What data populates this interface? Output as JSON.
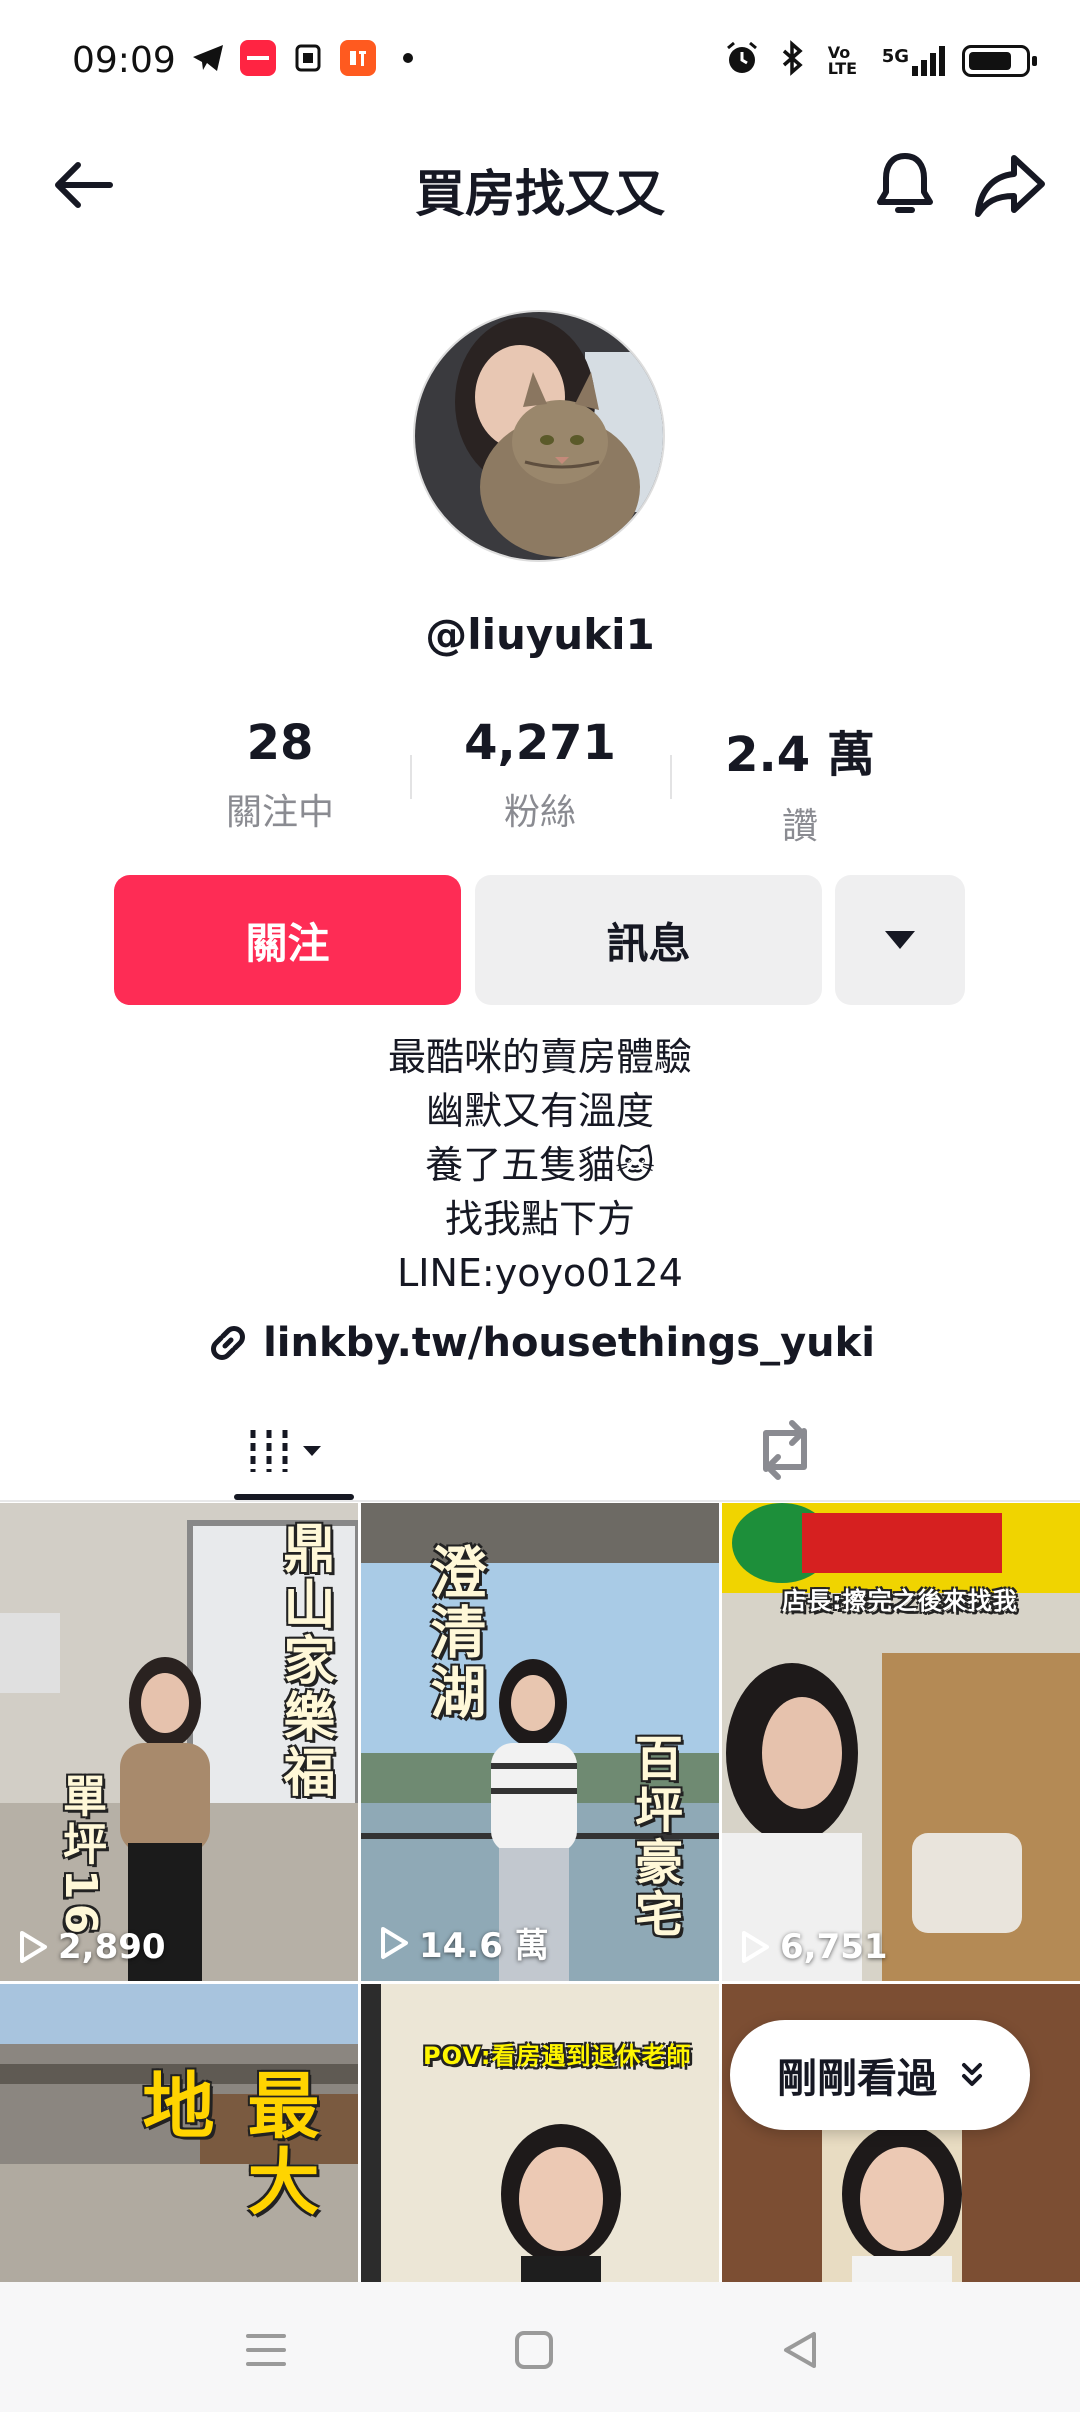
{
  "status_bar": {
    "time": "09:09",
    "left_icons": [
      "telegram-icon",
      "xiaohongshu-icon",
      "notes-icon",
      "ting-icon",
      "dot-icon"
    ],
    "right_icons": [
      "alarm-icon",
      "bluetooth-icon",
      "volte-icon",
      "5g-signal-icon",
      "battery-icon"
    ],
    "network_label": "5G",
    "volte_label": "Vo LTE",
    "battery_level": 0.75
  },
  "header": {
    "title": "買房找又又"
  },
  "profile": {
    "username": "@liuyuki1",
    "stats": [
      {
        "value": "28",
        "label": "關注中"
      },
      {
        "value": "4,271",
        "label": "粉絲"
      },
      {
        "value": "2.4 萬",
        "label": "讚"
      }
    ],
    "follow_label": "關注",
    "message_label": "訊息",
    "bio": [
      "最酷咪的賣房體驗",
      "幽默又有溫度",
      "養了五隻貓🐱",
      "找我點下方",
      "LINE:yoyo0124"
    ],
    "link": "linkby.tw/housethings_yuki"
  },
  "tabs": {
    "active": "videos",
    "items": [
      "videos-tab",
      "reposts-tab"
    ]
  },
  "videos": [
    {
      "views": "2,890",
      "overlay": "鼎山家樂福",
      "overlay2": "單坪16",
      "bg": "#c9c5bd"
    },
    {
      "views": "14.6 萬",
      "overlay": "澄清湖",
      "overlay2": "百坪豪宅",
      "bg": "#9fc3e0"
    },
    {
      "views": "6,751",
      "overlay": "店長:擦完之後來找我",
      "overlay2": "",
      "bg": "#b99a6a"
    },
    {
      "views": "",
      "overlay": "最大地",
      "overlay2": "",
      "bg": "#a6a49c"
    },
    {
      "views": "",
      "overlay": "POV:看房遇到退休老師",
      "overlay2": "",
      "bg": "#e8e2d2"
    },
    {
      "views": "",
      "overlay": "",
      "overlay2": "",
      "bg": "#8a5a3c"
    }
  ],
  "recent_pill": {
    "label": "剛剛看過"
  },
  "colors": {
    "accent": "#fe2c55",
    "text": "#161823",
    "muted": "#8a8b91",
    "button_bg": "#efeff0"
  }
}
